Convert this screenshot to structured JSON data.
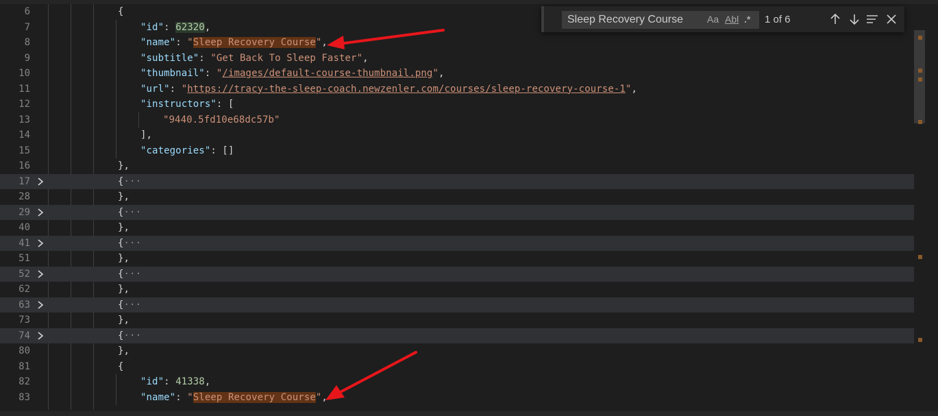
{
  "editor": {
    "lines": [
      {
        "num": "6",
        "indent": 3,
        "tokens": [
          {
            "t": "{",
            "c": "punc"
          }
        ]
      },
      {
        "num": "7",
        "indent": 4,
        "tokens": [
          {
            "t": "\"id\"",
            "c": "key"
          },
          {
            "t": ": ",
            "c": "punc"
          },
          {
            "t": "62320",
            "c": "num",
            "hl": true
          },
          {
            "t": ",",
            "c": "punc"
          }
        ]
      },
      {
        "num": "8",
        "indent": 4,
        "tokens": [
          {
            "t": "\"name\"",
            "c": "key"
          },
          {
            "t": ": ",
            "c": "punc"
          },
          {
            "t": "\"",
            "c": "str"
          },
          {
            "t": "Sleep Recovery Course",
            "c": "str",
            "match": true
          },
          {
            "t": "\"",
            "c": "str"
          },
          {
            "t": ",",
            "c": "punc"
          }
        ]
      },
      {
        "num": "9",
        "indent": 4,
        "tokens": [
          {
            "t": "\"subtitle\"",
            "c": "key"
          },
          {
            "t": ": ",
            "c": "punc"
          },
          {
            "t": "\"Get Back To Sleep Faster\"",
            "c": "str"
          },
          {
            "t": ",",
            "c": "punc"
          }
        ]
      },
      {
        "num": "10",
        "indent": 4,
        "tokens": [
          {
            "t": "\"thumbnail\"",
            "c": "key"
          },
          {
            "t": ": ",
            "c": "punc"
          },
          {
            "t": "\"",
            "c": "str"
          },
          {
            "t": "/images/default-course-thumbnail.png",
            "c": "link"
          },
          {
            "t": "\"",
            "c": "str"
          },
          {
            "t": ",",
            "c": "punc"
          }
        ]
      },
      {
        "num": "11",
        "indent": 4,
        "tokens": [
          {
            "t": "\"url\"",
            "c": "key"
          },
          {
            "t": ": ",
            "c": "punc"
          },
          {
            "t": "\"",
            "c": "str"
          },
          {
            "t": "https://tracy-the-sleep-coach.newzenler.com/courses/sleep-recovery-course-1",
            "c": "link"
          },
          {
            "t": "\"",
            "c": "str"
          },
          {
            "t": ",",
            "c": "punc"
          }
        ]
      },
      {
        "num": "12",
        "indent": 4,
        "tokens": [
          {
            "t": "\"instructors\"",
            "c": "key"
          },
          {
            "t": ": [",
            "c": "punc"
          }
        ]
      },
      {
        "num": "13",
        "indent": 5,
        "tokens": [
          {
            "t": "\"9440.5fd10e68dc57b\"",
            "c": "str"
          }
        ]
      },
      {
        "num": "14",
        "indent": 4,
        "tokens": [
          {
            "t": "],",
            "c": "punc"
          }
        ]
      },
      {
        "num": "15",
        "indent": 4,
        "tokens": [
          {
            "t": "\"categories\"",
            "c": "key"
          },
          {
            "t": ": []",
            "c": "punc"
          }
        ]
      },
      {
        "num": "16",
        "indent": 3,
        "tokens": [
          {
            "t": "},",
            "c": "punc"
          }
        ]
      },
      {
        "num": "17",
        "indent": 3,
        "folded": true,
        "tokens": [
          {
            "t": "{",
            "c": "punc"
          },
          {
            "t": "···",
            "c": "ellipsis"
          }
        ]
      },
      {
        "num": "28",
        "indent": 3,
        "tokens": [
          {
            "t": "},",
            "c": "punc"
          }
        ]
      },
      {
        "num": "29",
        "indent": 3,
        "folded": true,
        "tokens": [
          {
            "t": "{",
            "c": "punc"
          },
          {
            "t": "···",
            "c": "ellipsis"
          }
        ]
      },
      {
        "num": "40",
        "indent": 3,
        "tokens": [
          {
            "t": "},",
            "c": "punc"
          }
        ]
      },
      {
        "num": "41",
        "indent": 3,
        "folded": true,
        "tokens": [
          {
            "t": "{",
            "c": "punc"
          },
          {
            "t": "···",
            "c": "ellipsis"
          }
        ]
      },
      {
        "num": "51",
        "indent": 3,
        "tokens": [
          {
            "t": "},",
            "c": "punc"
          }
        ]
      },
      {
        "num": "52",
        "indent": 3,
        "folded": true,
        "tokens": [
          {
            "t": "{",
            "c": "punc"
          },
          {
            "t": "···",
            "c": "ellipsis"
          }
        ]
      },
      {
        "num": "62",
        "indent": 3,
        "tokens": [
          {
            "t": "},",
            "c": "punc"
          }
        ]
      },
      {
        "num": "63",
        "indent": 3,
        "folded": true,
        "tokens": [
          {
            "t": "{",
            "c": "punc"
          },
          {
            "t": "···",
            "c": "ellipsis"
          }
        ]
      },
      {
        "num": "73",
        "indent": 3,
        "tokens": [
          {
            "t": "},",
            "c": "punc"
          }
        ]
      },
      {
        "num": "74",
        "indent": 3,
        "folded": true,
        "tokens": [
          {
            "t": "{",
            "c": "punc"
          },
          {
            "t": "···",
            "c": "ellipsis"
          }
        ]
      },
      {
        "num": "80",
        "indent": 3,
        "tokens": [
          {
            "t": "},",
            "c": "punc"
          }
        ]
      },
      {
        "num": "81",
        "indent": 3,
        "tokens": [
          {
            "t": "{",
            "c": "punc"
          }
        ]
      },
      {
        "num": "82",
        "indent": 4,
        "tokens": [
          {
            "t": "\"id\"",
            "c": "key"
          },
          {
            "t": ": ",
            "c": "punc"
          },
          {
            "t": "41338",
            "c": "num"
          },
          {
            "t": ",",
            "c": "punc"
          }
        ]
      },
      {
        "num": "83",
        "indent": 4,
        "tokens": [
          {
            "t": "\"name\"",
            "c": "key"
          },
          {
            "t": ": ",
            "c": "punc"
          },
          {
            "t": "\"",
            "c": "str"
          },
          {
            "t": "Sleep Recovery Course",
            "c": "str",
            "match": true
          },
          {
            "t": "\"",
            "c": "str"
          },
          {
            "t": ",",
            "c": "punc"
          }
        ]
      }
    ]
  },
  "find": {
    "query": "Sleep Recovery Course",
    "match_case_label": "Aa",
    "whole_word_label": "Abl",
    "regex_label": ".*",
    "result_count": "1 of 6",
    "icons": {
      "previous": "arrow-up-icon",
      "next": "arrow-down-icon",
      "selection": "find-in-selection-icon",
      "close": "close-icon"
    }
  },
  "colors": {
    "background": "#1e1e1e",
    "match_highlight": "#623315",
    "annotation_arrow": "#e8161b"
  }
}
